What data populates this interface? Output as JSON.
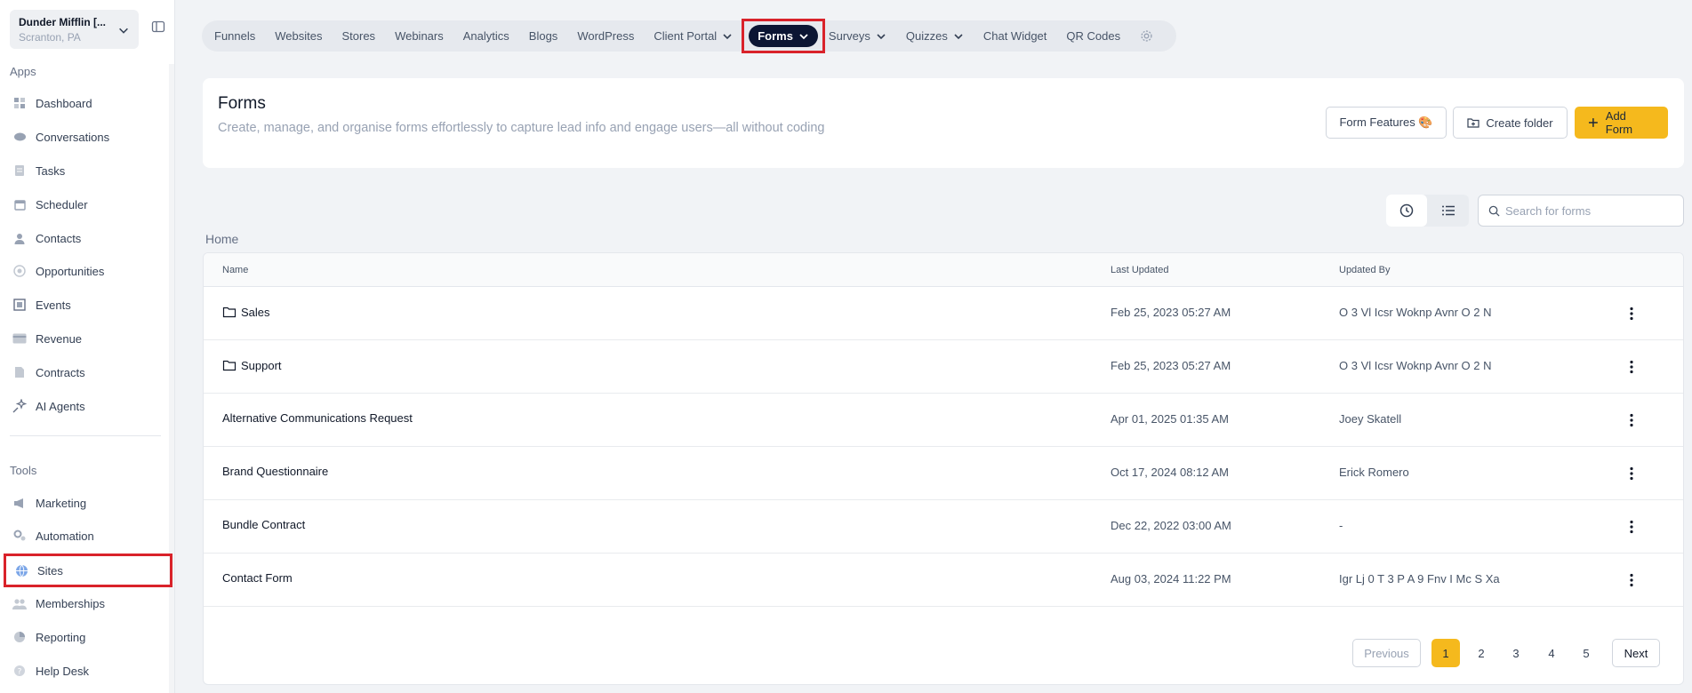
{
  "account": {
    "name": "Dunder Mifflin [...",
    "location": "Scranton, PA"
  },
  "sidebar": {
    "apps_title": "Apps",
    "apps": [
      {
        "label": "Dashboard",
        "icon": "dashboard-icon"
      },
      {
        "label": "Conversations",
        "icon": "chat-icon"
      },
      {
        "label": "Tasks",
        "icon": "tasks-icon"
      },
      {
        "label": "Scheduler",
        "icon": "calendar-icon"
      },
      {
        "label": "Contacts",
        "icon": "user-icon"
      },
      {
        "label": "Opportunities",
        "icon": "target-icon"
      },
      {
        "label": "Events",
        "icon": "events-icon"
      },
      {
        "label": "Revenue",
        "icon": "card-icon"
      },
      {
        "label": "Contracts",
        "icon": "document-icon"
      },
      {
        "label": "AI Agents",
        "icon": "sparkle-icon"
      }
    ],
    "tools_title": "Tools",
    "tools": [
      {
        "label": "Marketing",
        "icon": "megaphone-icon"
      },
      {
        "label": "Automation",
        "icon": "gears-icon"
      },
      {
        "label": "Sites",
        "icon": "globe-icon",
        "active": true
      },
      {
        "label": "Memberships",
        "icon": "members-icon"
      },
      {
        "label": "Reporting",
        "icon": "pie-icon"
      },
      {
        "label": "Help Desk",
        "icon": "help-icon"
      }
    ]
  },
  "topnav": {
    "items": [
      "Funnels",
      "Websites",
      "Stores",
      "Webinars",
      "Analytics",
      "Blogs",
      "WordPress"
    ],
    "client_portal": "Client Portal",
    "active": "Forms",
    "after": [
      "Surveys",
      "Quizzes"
    ],
    "tail": [
      "Chat Widget",
      "QR Codes"
    ]
  },
  "header": {
    "title": "Forms",
    "description": "Create, manage, and organise forms effortlessly to capture lead info and engage users—all without coding",
    "form_features_label": "Form Features 🎨",
    "create_folder_label": "Create folder",
    "add_form_label": "Add Form"
  },
  "search": {
    "placeholder": "Search for forms"
  },
  "breadcrumb": "Home",
  "table": {
    "columns": {
      "name": "Name",
      "updated": "Last Updated",
      "by": "Updated By"
    },
    "rows": [
      {
        "name": "Sales",
        "folder": true,
        "updated": "Feb 25, 2023 05:27 AM",
        "by": "O 3 Vl Icsr Woknp Avnr O 2 N"
      },
      {
        "name": "Support",
        "folder": true,
        "updated": "Feb 25, 2023 05:27 AM",
        "by": "O 3 Vl Icsr Woknp Avnr O 2 N"
      },
      {
        "name": "Alternative Communications Request",
        "folder": false,
        "updated": "Apr 01, 2025 01:35 AM",
        "by": "Joey Skatell"
      },
      {
        "name": "Brand Questionnaire",
        "folder": false,
        "updated": "Oct 17, 2024 08:12 AM",
        "by": "Erick Romero"
      },
      {
        "name": "Bundle Contract",
        "folder": false,
        "updated": "Dec 22, 2022 03:00 AM",
        "by": "-"
      },
      {
        "name": "Contact Form",
        "folder": false,
        "updated": "Aug 03, 2024 11:22 PM",
        "by": "Igr Lj 0 T 3 P A 9 Fnv I Mc S Xa"
      }
    ]
  },
  "pagination": {
    "previous": "Previous",
    "pages": [
      "1",
      "2",
      "3",
      "4",
      "5"
    ],
    "current": "1",
    "next": "Next"
  },
  "colors": {
    "accent": "#f5b91d",
    "nav_active": "#0b1533",
    "highlight": "#d9222a"
  }
}
